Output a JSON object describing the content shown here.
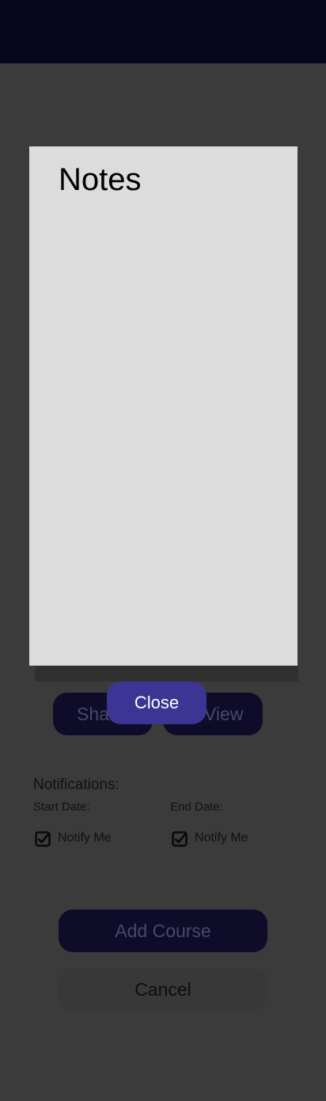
{
  "underlay": {
    "share_label": "Share",
    "view_label": "View",
    "notifications_heading": "Notifications:",
    "start_date_label": "Start Date:",
    "end_date_label": "End Date:",
    "notify_start_label": "Notify Me",
    "notify_end_label": "Notify Me",
    "notify_start_checked": true,
    "notify_end_checked": true,
    "add_course_label": "Add Course",
    "cancel_label": "Cancel"
  },
  "modal": {
    "title": "Notes",
    "close_label": "Close"
  },
  "colors": {
    "header": "#08061f",
    "overlay": "#3b3b3b",
    "modal_background": "#dcdcdc",
    "primary_button": "#3d3593"
  }
}
